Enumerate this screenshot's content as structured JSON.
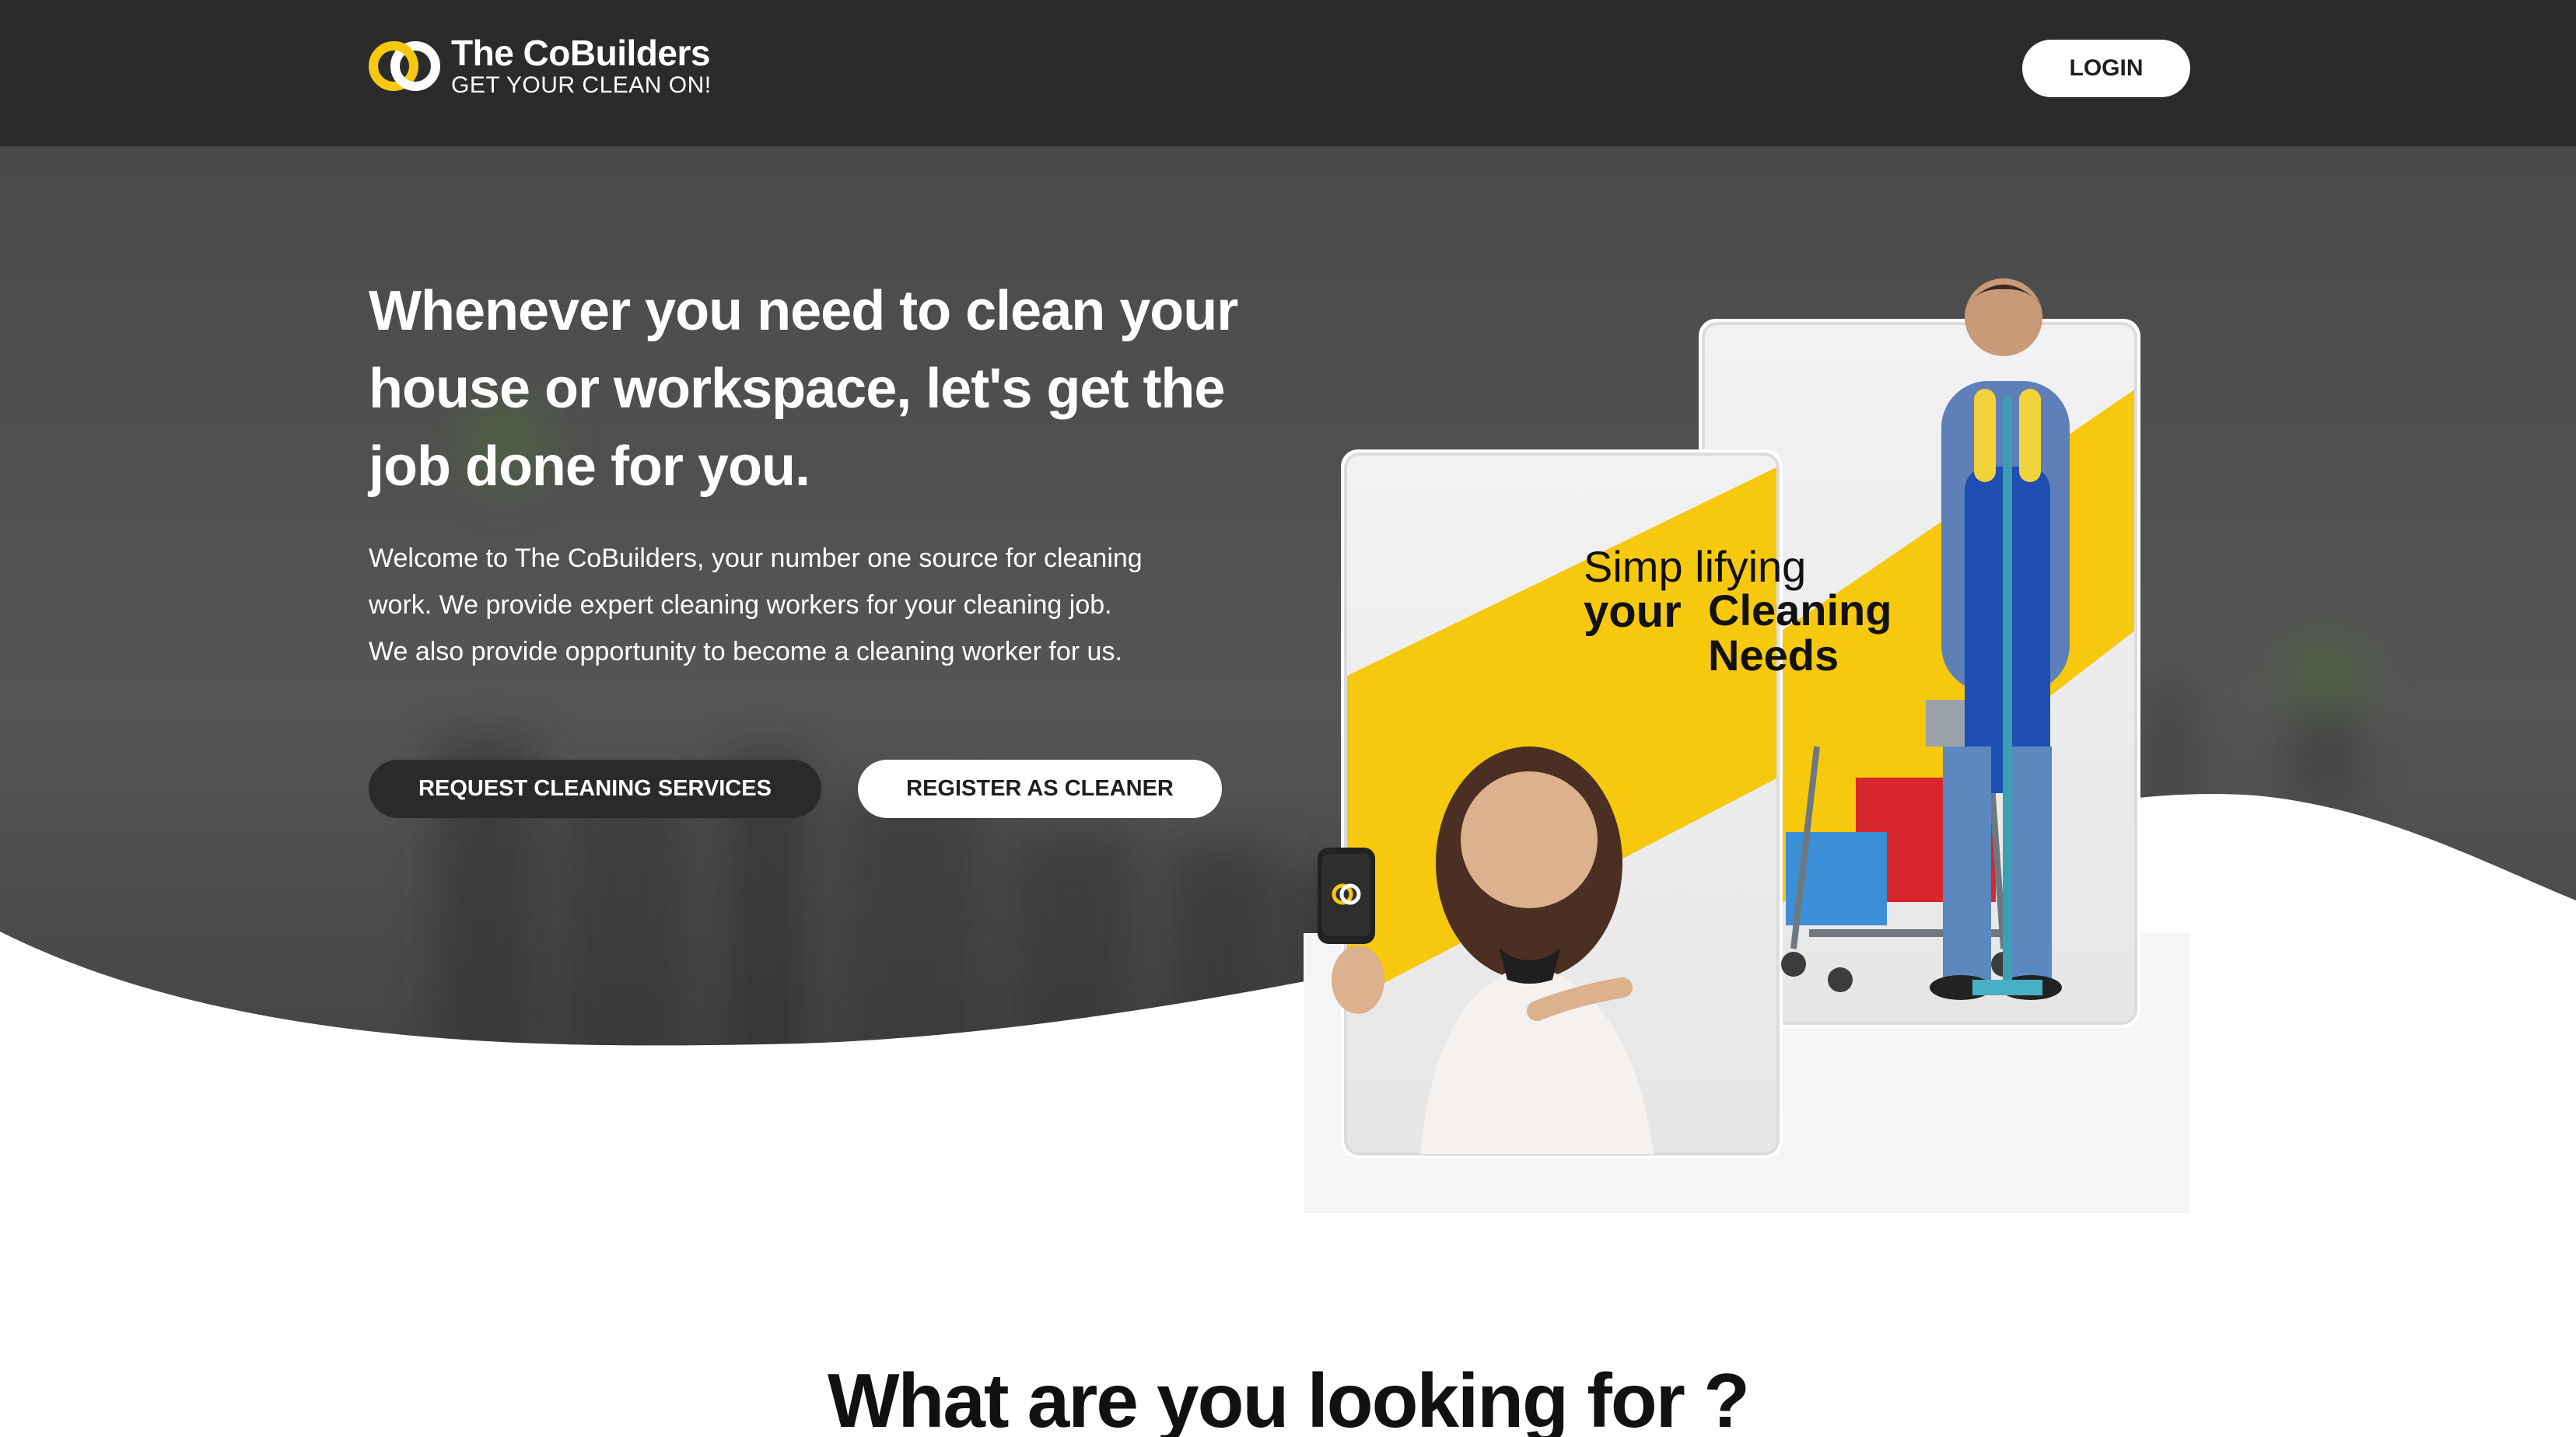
{
  "header": {
    "brand_name": "The CoBuilders",
    "brand_tagline": "GET YOUR CLEAN ON!",
    "login_label": "LOGIN"
  },
  "hero": {
    "title": "Whenever you need to clean your house or workspace, let's get the job done for you.",
    "description": "Welcome to The CoBuilders, your number one source for cleaning work. We provide expert cleaning workers for your cleaning job. We also provide opportunity to become a cleaning worker for us.",
    "primary_button": "REQUEST CLEANING SERVICES",
    "secondary_button": "REGISTER AS CLEANER",
    "promo": {
      "line1": "Simp lifying",
      "line2": "your",
      "line3": "Cleaning Needs"
    }
  },
  "section": {
    "title": "What are you looking for ?"
  },
  "colors": {
    "header_bg": "#2b2b2b",
    "hero_bg": "#4f4f4f",
    "accent_yellow": "#f6c90e",
    "button_dark": "#2a2a2a",
    "white": "#ffffff"
  },
  "icons": {
    "brand": "overlapping-rings-logo"
  }
}
